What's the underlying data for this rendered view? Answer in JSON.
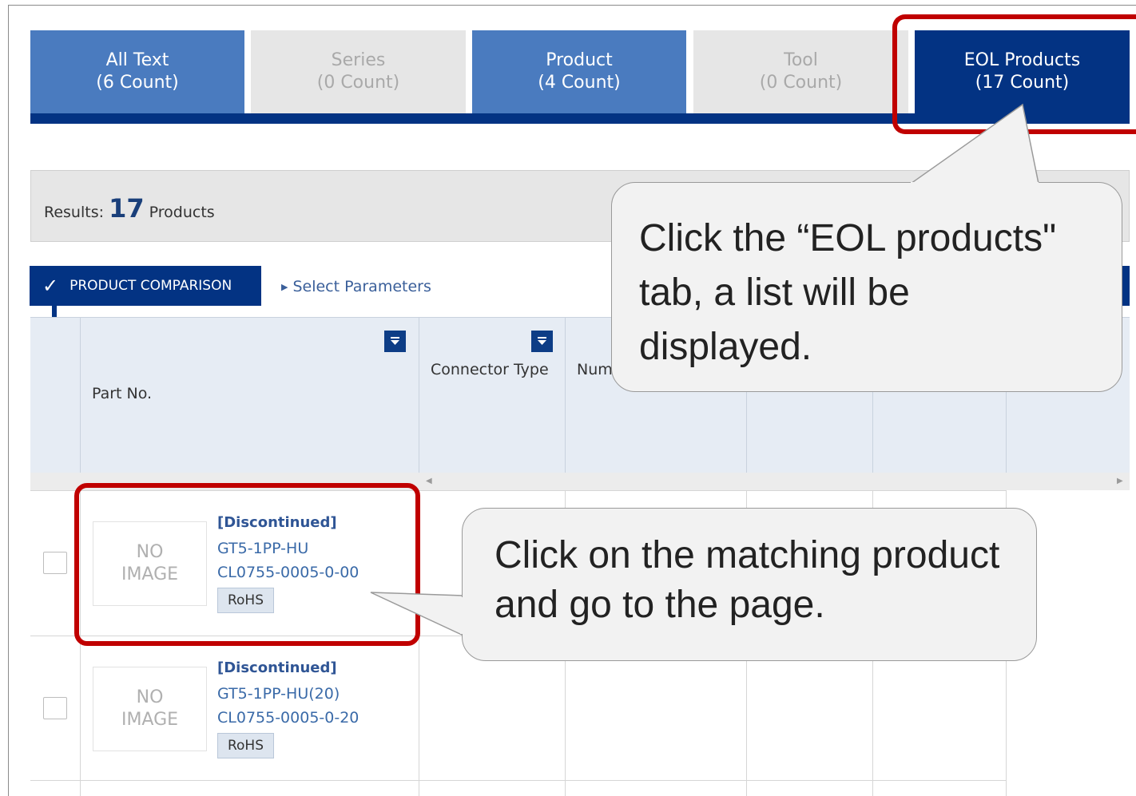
{
  "tabs": [
    {
      "label": "All Text",
      "count": "(6 Count)"
    },
    {
      "label": "Series",
      "count": "(0 Count)"
    },
    {
      "label": "Product",
      "count": "(4 Count)"
    },
    {
      "label": "Tool",
      "count": "(0 Count)"
    },
    {
      "label": "EOL Products",
      "count": "(17 Count)"
    }
  ],
  "results": {
    "prefix": "Results:",
    "count": "17",
    "suffix": "Products"
  },
  "toolbar": {
    "compare_label": "PRODUCT COMPARISON",
    "select_params": "Select Parameters"
  },
  "table": {
    "headers": {
      "part_no": "Part No.",
      "connector_type": "Connector Type",
      "num": "Num"
    },
    "rows": [
      {
        "status": "[Discontinued]",
        "part_no": "GT5-1PP-HU",
        "code": "CL0755-0005-0-00",
        "badge": "RoHS",
        "image": {
          "line1": "NO",
          "line2": "IMAGE"
        }
      },
      {
        "status": "[Discontinued]",
        "part_no": "GT5-1PP-HU(20)",
        "code": "CL0755-0005-0-20",
        "badge": "RoHS",
        "image": {
          "line1": "NO",
          "line2": "IMAGE"
        }
      }
    ]
  },
  "callouts": {
    "eol": "Click the “EOL products\" tab, a list will be displayed.",
    "product": "Click on the matching product and go to the page."
  },
  "colors": {
    "tab_blue": "#4a7bbf",
    "tab_selected": "#033383",
    "highlight": "#c00000"
  }
}
